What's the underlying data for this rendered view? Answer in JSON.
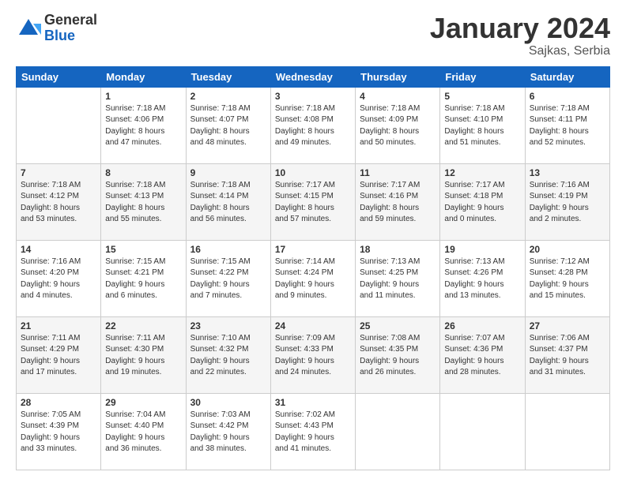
{
  "header": {
    "logo": {
      "general": "General",
      "blue": "Blue"
    },
    "title": "January 2024",
    "subtitle": "Sajkas, Serbia"
  },
  "weekdays": [
    "Sunday",
    "Monday",
    "Tuesday",
    "Wednesday",
    "Thursday",
    "Friday",
    "Saturday"
  ],
  "weeks": [
    [
      {
        "day": null
      },
      {
        "day": 1,
        "sunrise": "7:18 AM",
        "sunset": "4:06 PM",
        "daylight": "8 hours and 47 minutes."
      },
      {
        "day": 2,
        "sunrise": "7:18 AM",
        "sunset": "4:07 PM",
        "daylight": "8 hours and 48 minutes."
      },
      {
        "day": 3,
        "sunrise": "7:18 AM",
        "sunset": "4:08 PM",
        "daylight": "8 hours and 49 minutes."
      },
      {
        "day": 4,
        "sunrise": "7:18 AM",
        "sunset": "4:09 PM",
        "daylight": "8 hours and 50 minutes."
      },
      {
        "day": 5,
        "sunrise": "7:18 AM",
        "sunset": "4:10 PM",
        "daylight": "8 hours and 51 minutes."
      },
      {
        "day": 6,
        "sunrise": "7:18 AM",
        "sunset": "4:11 PM",
        "daylight": "8 hours and 52 minutes."
      }
    ],
    [
      {
        "day": 7,
        "sunrise": "7:18 AM",
        "sunset": "4:12 PM",
        "daylight": "8 hours and 53 minutes."
      },
      {
        "day": 8,
        "sunrise": "7:18 AM",
        "sunset": "4:13 PM",
        "daylight": "8 hours and 55 minutes."
      },
      {
        "day": 9,
        "sunrise": "7:18 AM",
        "sunset": "4:14 PM",
        "daylight": "8 hours and 56 minutes."
      },
      {
        "day": 10,
        "sunrise": "7:17 AM",
        "sunset": "4:15 PM",
        "daylight": "8 hours and 57 minutes."
      },
      {
        "day": 11,
        "sunrise": "7:17 AM",
        "sunset": "4:16 PM",
        "daylight": "8 hours and 59 minutes."
      },
      {
        "day": 12,
        "sunrise": "7:17 AM",
        "sunset": "4:18 PM",
        "daylight": "9 hours and 0 minutes."
      },
      {
        "day": 13,
        "sunrise": "7:16 AM",
        "sunset": "4:19 PM",
        "daylight": "9 hours and 2 minutes."
      }
    ],
    [
      {
        "day": 14,
        "sunrise": "7:16 AM",
        "sunset": "4:20 PM",
        "daylight": "9 hours and 4 minutes."
      },
      {
        "day": 15,
        "sunrise": "7:15 AM",
        "sunset": "4:21 PM",
        "daylight": "9 hours and 6 minutes."
      },
      {
        "day": 16,
        "sunrise": "7:15 AM",
        "sunset": "4:22 PM",
        "daylight": "9 hours and 7 minutes."
      },
      {
        "day": 17,
        "sunrise": "7:14 AM",
        "sunset": "4:24 PM",
        "daylight": "9 hours and 9 minutes."
      },
      {
        "day": 18,
        "sunrise": "7:13 AM",
        "sunset": "4:25 PM",
        "daylight": "9 hours and 11 minutes."
      },
      {
        "day": 19,
        "sunrise": "7:13 AM",
        "sunset": "4:26 PM",
        "daylight": "9 hours and 13 minutes."
      },
      {
        "day": 20,
        "sunrise": "7:12 AM",
        "sunset": "4:28 PM",
        "daylight": "9 hours and 15 minutes."
      }
    ],
    [
      {
        "day": 21,
        "sunrise": "7:11 AM",
        "sunset": "4:29 PM",
        "daylight": "9 hours and 17 minutes."
      },
      {
        "day": 22,
        "sunrise": "7:11 AM",
        "sunset": "4:30 PM",
        "daylight": "9 hours and 19 minutes."
      },
      {
        "day": 23,
        "sunrise": "7:10 AM",
        "sunset": "4:32 PM",
        "daylight": "9 hours and 22 minutes."
      },
      {
        "day": 24,
        "sunrise": "7:09 AM",
        "sunset": "4:33 PM",
        "daylight": "9 hours and 24 minutes."
      },
      {
        "day": 25,
        "sunrise": "7:08 AM",
        "sunset": "4:35 PM",
        "daylight": "9 hours and 26 minutes."
      },
      {
        "day": 26,
        "sunrise": "7:07 AM",
        "sunset": "4:36 PM",
        "daylight": "9 hours and 28 minutes."
      },
      {
        "day": 27,
        "sunrise": "7:06 AM",
        "sunset": "4:37 PM",
        "daylight": "9 hours and 31 minutes."
      }
    ],
    [
      {
        "day": 28,
        "sunrise": "7:05 AM",
        "sunset": "4:39 PM",
        "daylight": "9 hours and 33 minutes."
      },
      {
        "day": 29,
        "sunrise": "7:04 AM",
        "sunset": "4:40 PM",
        "daylight": "9 hours and 36 minutes."
      },
      {
        "day": 30,
        "sunrise": "7:03 AM",
        "sunset": "4:42 PM",
        "daylight": "9 hours and 38 minutes."
      },
      {
        "day": 31,
        "sunrise": "7:02 AM",
        "sunset": "4:43 PM",
        "daylight": "9 hours and 41 minutes."
      },
      {
        "day": null
      },
      {
        "day": null
      },
      {
        "day": null
      }
    ]
  ],
  "labels": {
    "sunrise": "Sunrise:",
    "sunset": "Sunset:",
    "daylight": "Daylight:"
  }
}
